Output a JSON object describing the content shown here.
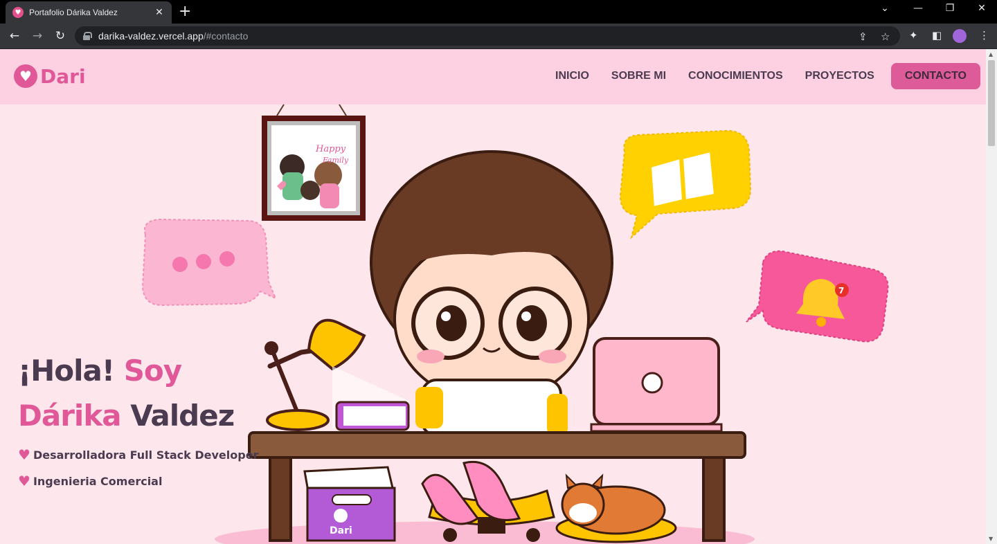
{
  "browser": {
    "tab_title": "Portafolio Dárika Valdez",
    "url_host": "darika-valdez.vercel.app",
    "url_path": "/#contacto"
  },
  "site": {
    "logo_text": "Dari",
    "nav": [
      "INICIO",
      "SOBRE MI",
      "CONOCIMIENTOS",
      "PROYECTOS",
      "CONTACTO"
    ],
    "active_nav": "CONTACTO",
    "hero": {
      "greeting": "¡Hola!",
      "soy": "Soy",
      "first_name": "Dárika",
      "last_name": "Valdez",
      "lines": [
        "Desarrolladora Full Stack Developer",
        "Ingenieria Comercial"
      ]
    },
    "illustration": {
      "frame_text_1": "Happy",
      "frame_text_2": "Family",
      "box_label": "Dari",
      "notification_count": "7"
    }
  },
  "colors": {
    "accent": "#e05898",
    "header_bg": "#fdd0e2",
    "page_bg": "#fee7ec",
    "text_dark": "#4a3b50"
  }
}
